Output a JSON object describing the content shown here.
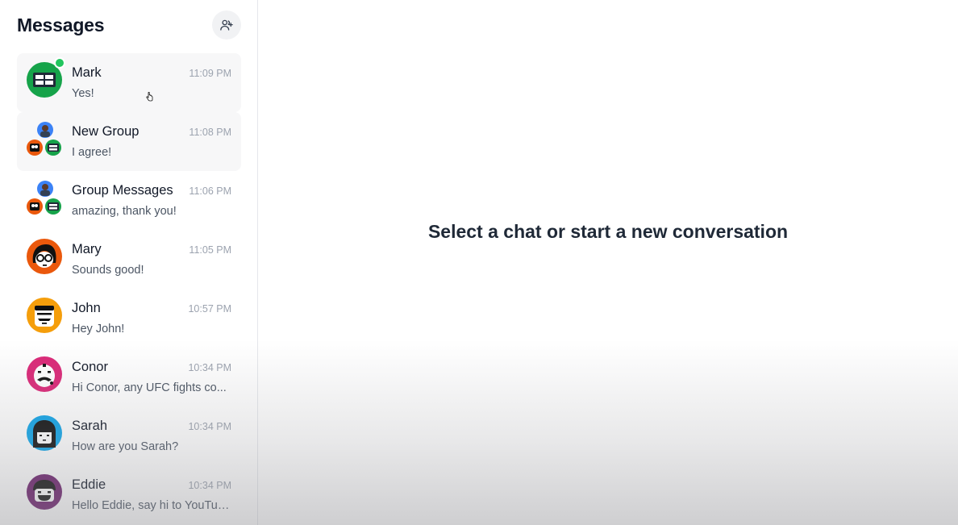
{
  "sidebar": {
    "title": "Messages",
    "new_chat_icon": "add-user-icon",
    "conversations": [
      {
        "name": "Mark",
        "time": "11:09 PM",
        "preview": "Yes!",
        "avatar": "green-robot",
        "online": true
      },
      {
        "name": "New Group",
        "time": "11:08 PM",
        "preview": "I agree!",
        "avatar": "group"
      },
      {
        "name": "Group Messages",
        "time": "11:06 PM",
        "preview": "amazing, thank you!",
        "avatar": "group"
      },
      {
        "name": "Mary",
        "time": "11:05 PM",
        "preview": "Sounds good!",
        "avatar": "orange-glasses"
      },
      {
        "name": "John",
        "time": "10:57 PM",
        "preview": "Hey John!",
        "avatar": "orange-mustache"
      },
      {
        "name": "Conor",
        "time": "10:34 PM",
        "preview": "Hi Conor, any UFC fights co...",
        "avatar": "pink-face"
      },
      {
        "name": "Sarah",
        "time": "10:34 PM",
        "preview": "How are you Sarah?",
        "avatar": "blue-hair"
      },
      {
        "name": "Eddie",
        "time": "10:34 PM",
        "preview": "Hello Eddie, say hi to YouTube!",
        "avatar": "purple-smile"
      }
    ]
  },
  "main": {
    "empty_state": "Select a chat or start a new conversation"
  },
  "colors": {
    "online": "#22c55e",
    "selected_row": "#f7f7f8",
    "mark_avatar": "#16a34a",
    "mary_avatar": "#ea580c",
    "john_avatar": "#f59e0b",
    "conor_avatar": "#db2777",
    "sarah_avatar": "#0ea5e9",
    "eddie_avatar": "#6b1d6b"
  }
}
